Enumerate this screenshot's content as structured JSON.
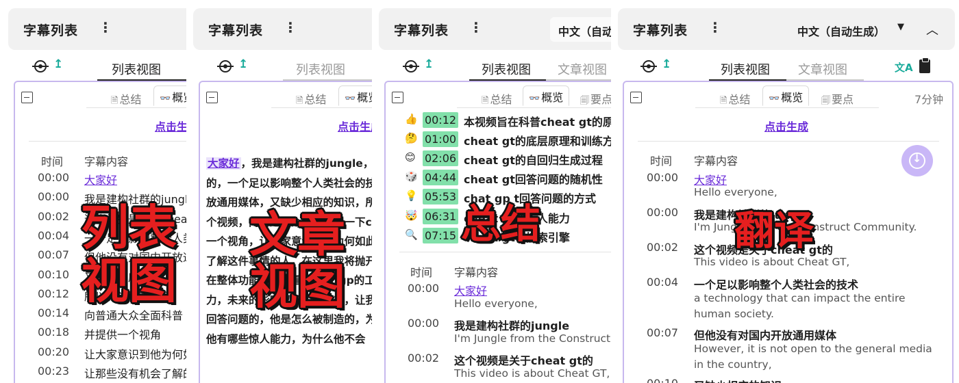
{
  "colors": {
    "accent_purple": "#6a2bd9",
    "time_badge_green": "#82e0aa",
    "overlay_red": "#e51f1f",
    "card_border": "#c7b8ee",
    "icon_teal": "#1aab9b"
  },
  "header": {
    "title": "字幕列表",
    "more_icon": "more-vertical-icon"
  },
  "tabs": {
    "list": "列表视图",
    "article": "文章视图"
  },
  "segments": {
    "summary": "总结",
    "overview": "概览",
    "keypoints": "要点"
  },
  "generate_link": "点击生成",
  "table": {
    "time_header": "时间",
    "content_header": "字幕内容"
  },
  "panel1": {
    "overlay": [
      "列表",
      "视图"
    ],
    "rows": [
      {
        "time": "00:00",
        "text": "大家好"
      },
      {
        "time": "00:00",
        "text": "我是建构社群的jungle"
      },
      {
        "time": "00:02",
        "text": "这个视频是关于cheat gt的"
      },
      {
        "time": "00:04",
        "text": "一个足以影响整个人类社会的技术"
      },
      {
        "time": "00:07",
        "text": "但他没有对国内开放通用媒体"
      },
      {
        "time": "00:10",
        "text": "又缺少相应的知识"
      },
      {
        "time": "00:12",
        "text": "所以我觉得有义务"
      },
      {
        "time": "00:14",
        "text": "向普通大众全面科普"
      },
      {
        "time": "00:18",
        "text": "并提供一个视角"
      },
      {
        "time": "00:20",
        "text": "让大家意识到他为何如此重要"
      },
      {
        "time": "00:23",
        "text": "让那些没有机会了解的人"
      }
    ]
  },
  "panel2": {
    "overlay": [
      "文章",
      "视图"
    ],
    "article_link": "大家好",
    "lines": [
      "，我是建构社群的jungle，这",
      "的，一个足以影响整个人类社会的技术",
      "放通用媒体，又缺少相应的知识，所以",
      "个视频，向普通大众全面科普一下cheat",
      "一个视角，让大家意识到他为何如此重要",
      "了解这件事情的人，在这里我将抛开",
      " 在整体功能上，来看cheat gp的工作原理",
      "力，未来的影响以及如何应对，让我们",
      "回答问题的，他是怎么被制造的，为",
      " 他有哪些惊人能力，为什么他不会"
    ]
  },
  "panel3": {
    "language": "中文（自动生成）",
    "overlay": [
      "总结"
    ],
    "summary": [
      {
        "emoji": "👍",
        "time": "00:12",
        "text": "本视频旨在科普cheat gt的原理"
      },
      {
        "emoji": "🤔",
        "time": "01:00",
        "text": "cheat gt的底层原理和训练方法"
      },
      {
        "emoji": "😊",
        "time": "02:06",
        "text": "cheat gt的自回归生成过程"
      },
      {
        "emoji": "🎲",
        "time": "04:44",
        "text": "cheat gt回答问题的随机性"
      },
      {
        "emoji": "💡",
        "time": "05:53",
        "text": "chat gp t回答问题的方式"
      },
      {
        "emoji": "🤯",
        "time": "06:31",
        "text": "cheat gt的惊人能力"
      },
      {
        "emoji": "🔍",
        "time": "07:15",
        "text": "cheat gt与搜索引擎"
      }
    ],
    "rows": [
      {
        "time": "00:00",
        "text": "大家好",
        "en": "Hello everyone,"
      },
      {
        "time": "00:00",
        "text": "我是建构社群的jungle",
        "en": "I'm Jungle from the Construct Community."
      },
      {
        "time": "00:02",
        "text": "这个视频是关于cheat gt的",
        "en": "This video is about Cheat GT,"
      }
    ]
  },
  "panel4": {
    "language": "中文（自动生成）",
    "duration": "7分钟",
    "overlay": [
      "翻译"
    ],
    "rows": [
      {
        "time": "00:00",
        "text": "大家好",
        "en": "Hello everyone,"
      },
      {
        "time": "00:00",
        "text": "我是建构社群的jungle",
        "en": "I'm Jungle from the Construct Community."
      },
      {
        "time": "00:02",
        "text": "这个视频是关于cheat gt的",
        "en": "This video is about Cheat GT,"
      },
      {
        "time": "00:04",
        "text": "一个足以影响整个人类社会的技术",
        "en": "a technology that can impact the entire human society."
      },
      {
        "time": "00:07",
        "text": "但他没有对国内开放通用媒体",
        "en": "However, it is not open to the general media in the country,"
      },
      {
        "time": "00:10",
        "text": "又缺少相应的知识",
        "en": ""
      }
    ]
  }
}
